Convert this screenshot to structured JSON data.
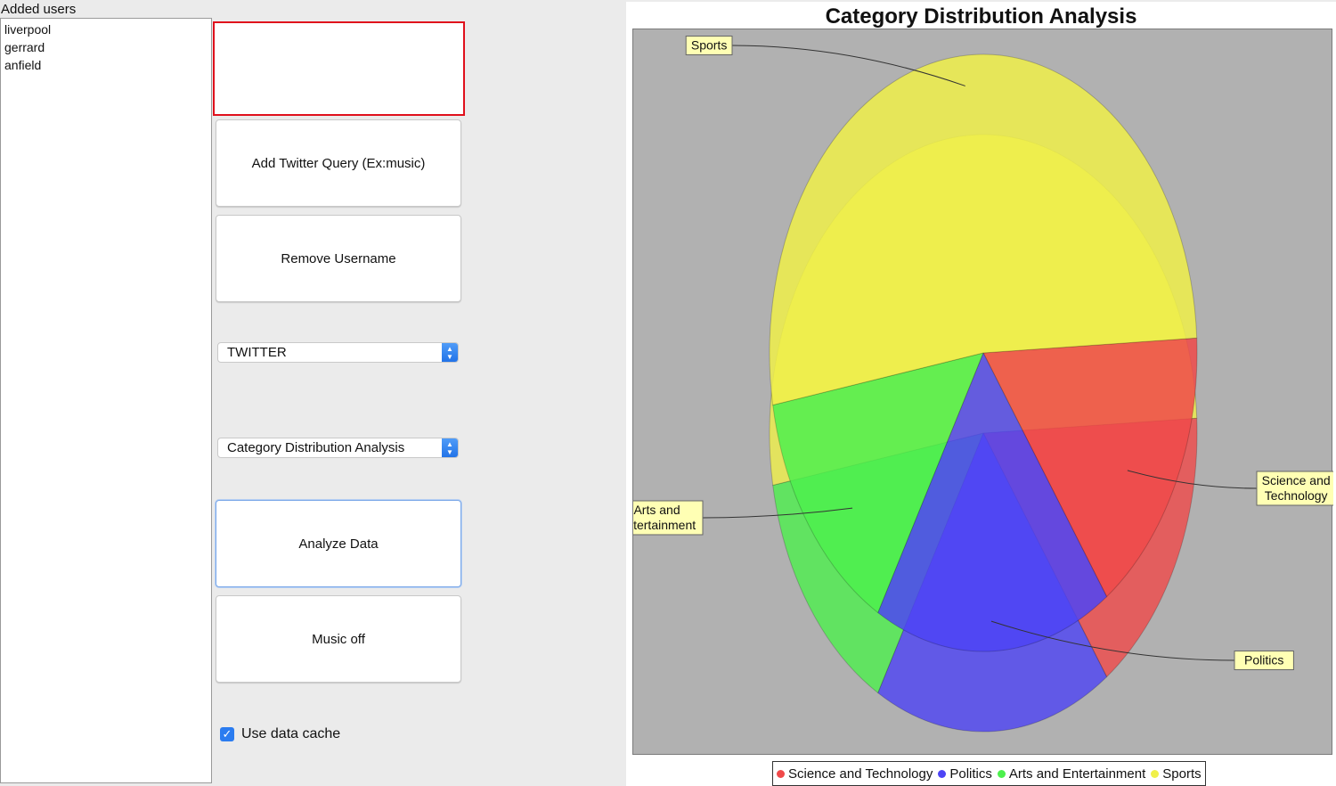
{
  "left_panel": {
    "users_label": "Added users",
    "users": [
      "liverpool",
      "gerrard",
      "anfield"
    ],
    "query_input_value": "",
    "buttons": {
      "add_query": "Add Twitter Query (Ex:music)",
      "remove_username": "Remove Username",
      "analyze": "Analyze Data",
      "music": "Music off"
    },
    "source_select": "TWITTER",
    "analysis_select": "Category Distribution Analysis",
    "cache_label": "Use data cache",
    "cache_checked": true
  },
  "chart_data": {
    "type": "pie",
    "title": "Category Distribution Analysis",
    "categories": [
      "Science and Technology",
      "Politics",
      "Arts and Entertainment",
      "Sports"
    ],
    "values": [
      16,
      18,
      14,
      52
    ],
    "colors": [
      "#f04a4a",
      "#4d44f5",
      "#4df04d",
      "#f0f04a"
    ],
    "labels": {
      "Science and Technology": "Science and\nTechnology",
      "Politics": "Politics",
      "Arts and Entertainment": "Arts and\nEntertainment",
      "Sports": "Sports"
    },
    "legend_position": "bottom",
    "style": "3d"
  }
}
